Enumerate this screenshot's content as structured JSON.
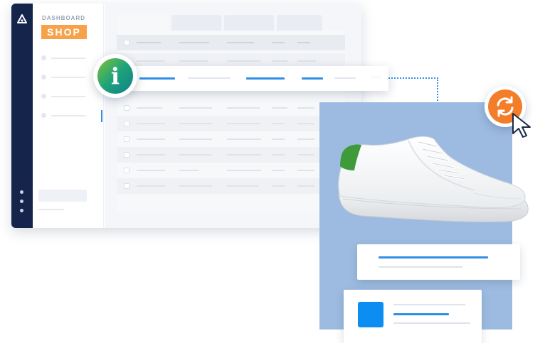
{
  "sidebar": {
    "brand_small": "DASHBOARD",
    "brand_name": "SHOP"
  },
  "info_badge": {
    "glyph": "i",
    "icon": "info-icon"
  },
  "sync_badge": {
    "icon": "sync-icon"
  },
  "highlighted_row": {
    "more": "···"
  },
  "colors": {
    "navy": "#14244a",
    "shop_badge": "#f7a24a",
    "accent_blue": "#2f8fe6",
    "info_green": "#1fa37a",
    "sync_orange": "#f47d2a",
    "panel_blue": "#9dbbe0",
    "shoe_heel": "#3f9a3a"
  }
}
